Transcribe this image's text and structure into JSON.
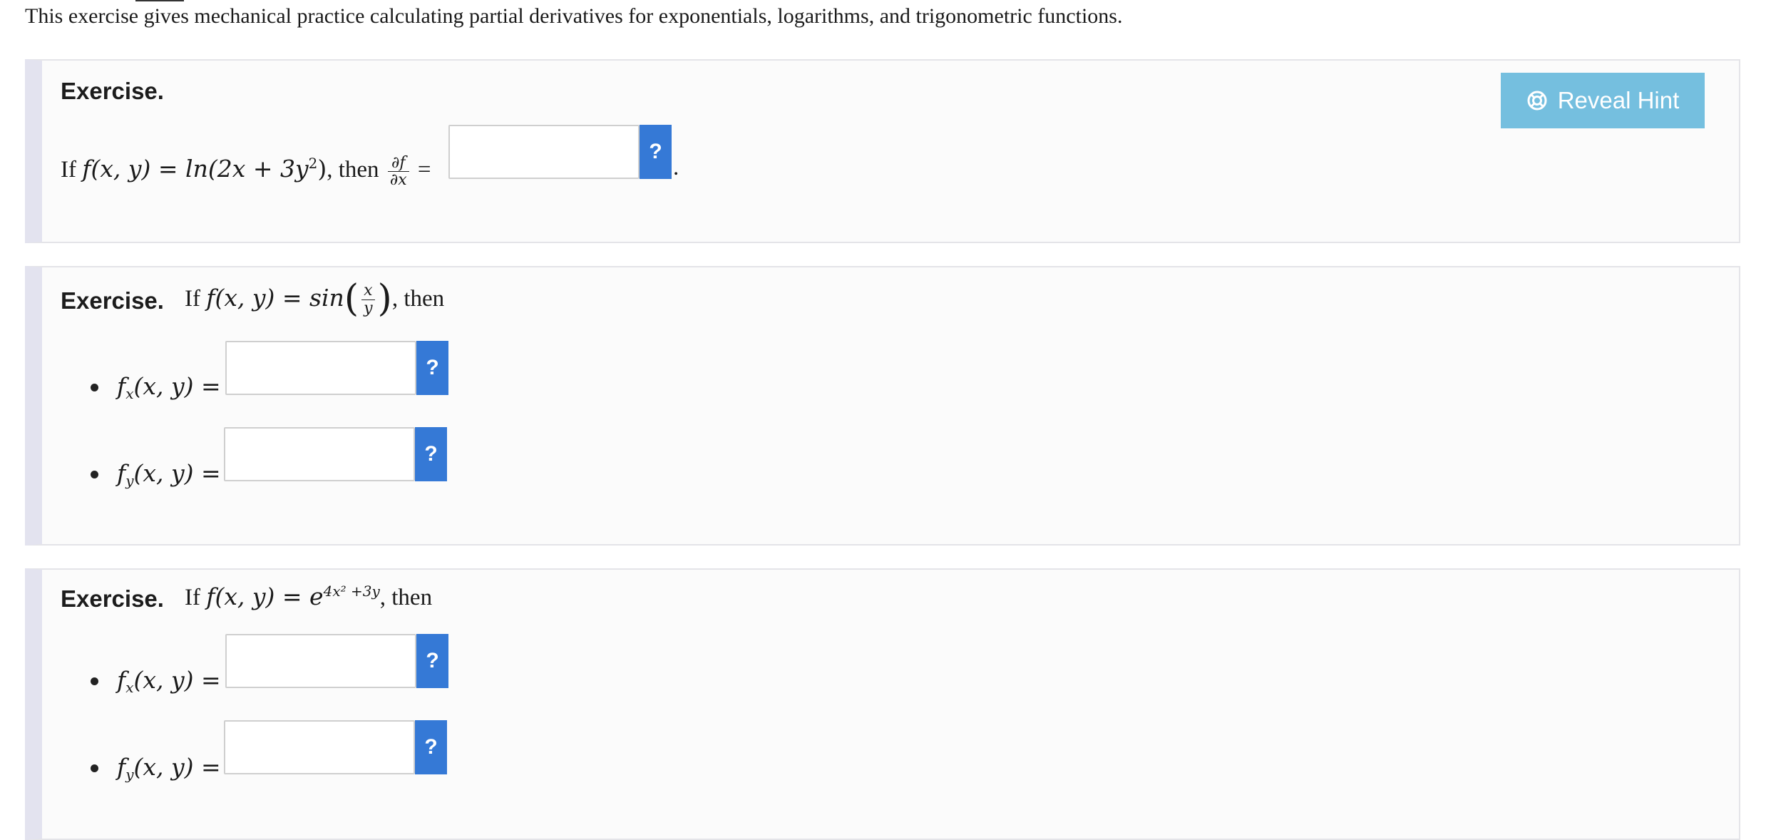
{
  "intro": "This exercise gives mechanical practice calculating partial derivatives for exponentials, logarithms, and trigonometric functions.",
  "exercise1": {
    "heading": "Exercise.",
    "hint_label": "Reveal Hint",
    "hint_icon": "lifebuoy-icon",
    "text_if": "If",
    "function": "f(x, y) = ln(2x + 3y",
    "function_exp": "2",
    "function_close": ")",
    "text_then": ", then",
    "deriv_num": "∂f",
    "deriv_den": "∂x",
    "equals": "=",
    "period": ".",
    "answer_value": "",
    "help_label": "?"
  },
  "exercise2": {
    "heading": "Exercise.",
    "text_if": "If",
    "function": "f(x, y) = sin",
    "frac_num": "x",
    "frac_den": "y",
    "text_then": ", then",
    "items": [
      {
        "prefix": "f",
        "sub": "x",
        "args": "(x, y) =",
        "answer_value": "",
        "help_label": "?"
      },
      {
        "prefix": "f",
        "sub": "y",
        "args": "(x, y) =",
        "answer_value": "",
        "help_label": "?"
      }
    ]
  },
  "exercise3": {
    "heading": "Exercise.",
    "text_if": "If",
    "function": "f(x, y) = e",
    "exponent": "4x² +3y",
    "text_then": ", then",
    "items": [
      {
        "prefix": "f",
        "sub": "x",
        "args": "(x, y) =",
        "answer_value": "",
        "help_label": "?"
      },
      {
        "prefix": "f",
        "sub": "y",
        "args": "(x, y) =",
        "answer_value": "",
        "help_label": "?"
      }
    ]
  },
  "colors": {
    "hint_button": "#75bfdf",
    "help_button": "#3579d6",
    "box_bg": "#fbfbfb",
    "box_accent": "#e3e3ef"
  }
}
